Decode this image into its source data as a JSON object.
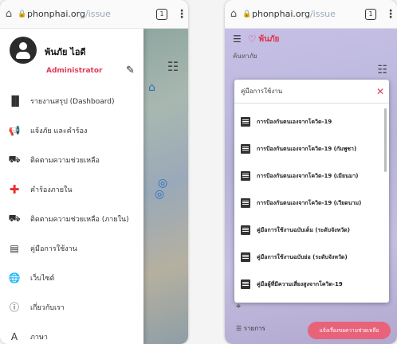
{
  "browser": {
    "left_url_host": "phonphai.org",
    "left_url_path": "/issue",
    "right_url_host": "phonphai.org",
    "right_url_path": "/issue",
    "tab_count": "1"
  },
  "profile": {
    "name": "พ้นภัย ไอดี",
    "role": "Administrator"
  },
  "drawer": {
    "items": [
      {
        "label": "รายงานสรุป (Dashboard)",
        "icon": "bar-chart-icon"
      },
      {
        "label": "แจ้งภัย และคำร้อง",
        "icon": "megaphone-icon"
      },
      {
        "label": "ติดตามความช่วยเหลือ",
        "icon": "truck-icon"
      },
      {
        "label": "คำร้องภายใน",
        "icon": "plus-icon"
      },
      {
        "label": "ติดตามความช่วยเหลือ (ภายใน)",
        "icon": "truck-icon"
      },
      {
        "label": "คู่มือการใช้งาน",
        "icon": "book-icon"
      },
      {
        "label": "เว็บไซต์",
        "icon": "globe-icon"
      },
      {
        "label": "เกี่ยวกับเรา",
        "icon": "info-icon"
      },
      {
        "label": "ภาษา",
        "icon": "language-icon"
      }
    ]
  },
  "app": {
    "brand": "พ้นภัย",
    "search_label": "ค้นหาภัย",
    "list_label": "รายการ",
    "report_label": "แจ้งเรื่องขอความช่วยเหลือ"
  },
  "manual": {
    "title": "คู่มือการใช้งาน",
    "docs": [
      "การป้องกันตนเองจากโควิด-19",
      "การป้องกันตนเองจากโควิด-19 (กัมพูชา)",
      "การป้องกันตนเองจากโควิด-19 (เมียนมา)",
      "การป้องกันตนเองจากโควิด-19 (เวียดนาม)",
      "คู่มือการใช้งานฉบับเต็ม (ระดับจังหวัด)",
      "คู่มือการใช้งานฉบับย่อ (ระดับจังหวัด)",
      "คู่มือผู้ที่มีความเสี่ยงสูงจากโควิด-19"
    ]
  },
  "colors": {
    "accent": "#e0334c",
    "role": "#e03a5a",
    "map_left": "#9aa9b8",
    "map_right": "#c0bae0"
  }
}
